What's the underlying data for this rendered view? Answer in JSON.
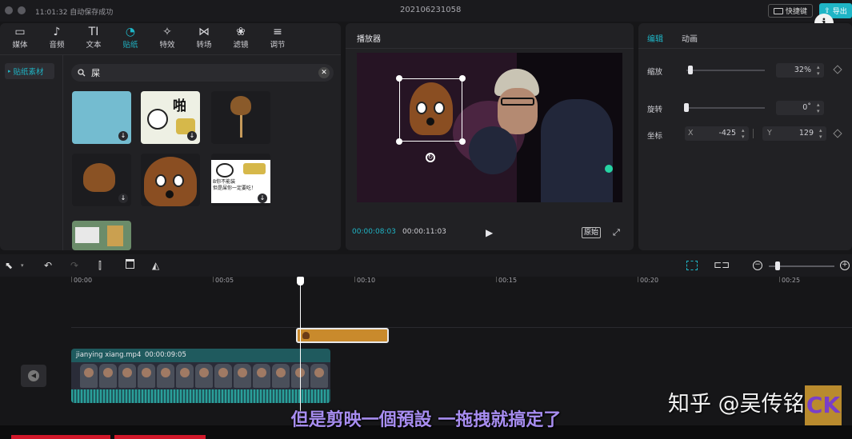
{
  "titlebar": {
    "autosave": "11:01:32 自动保存成功",
    "project_name": "202106231058",
    "shortcut_label": "快捷键",
    "export_label": "导出"
  },
  "toolbar": [
    {
      "label": "媒体",
      "icon": "media-icon"
    },
    {
      "label": "音频",
      "icon": "audio-icon"
    },
    {
      "label": "文本",
      "icon": "text-icon",
      "glyph": "TI"
    },
    {
      "label": "贴纸",
      "icon": "sticker-icon",
      "active": true
    },
    {
      "label": "特效",
      "icon": "effects-icon"
    },
    {
      "label": "转场",
      "icon": "transition-icon"
    },
    {
      "label": "滤镜",
      "icon": "filter-icon"
    },
    {
      "label": "调节",
      "icon": "adjust-icon"
    }
  ],
  "sidebar": {
    "item": "贴纸素材"
  },
  "search": {
    "query": "屎"
  },
  "stickers": {
    "panda_text_1": "啪",
    "panda_text_2": "B你不能装\n但是屎你一定要吃！"
  },
  "player": {
    "title": "播放器",
    "current_time": "00:00:08:03",
    "total_time": "00:00:11:03",
    "original_label": "原始"
  },
  "inspector": {
    "tabs": [
      "编辑",
      "动画"
    ],
    "scale_label": "缩放",
    "scale_value": "32%",
    "scale_fraction": 0.02,
    "rotate_label": "旋转",
    "rotate_value": "0˚",
    "rotate_fraction": 0.0,
    "position_label": "坐标",
    "x_label": "X",
    "x_value": "-425",
    "y_label": "Y",
    "y_value": "129"
  },
  "timeline": {
    "ticks": [
      "00:00",
      "00:05",
      "00:10",
      "00:15",
      "00:20",
      "00:25"
    ],
    "clip_name": "jianying xiang.mp4",
    "clip_duration": "00:00:09:05"
  },
  "overlay": {
    "subtitle": "但是剪映一個預設 一拖拽就搞定了",
    "watermark": "知乎 @吴传铭"
  },
  "colors": {
    "accent": "#1fb5c6",
    "sticker_clip": "#c98a2c",
    "video_clip": "#1f5a5e"
  }
}
